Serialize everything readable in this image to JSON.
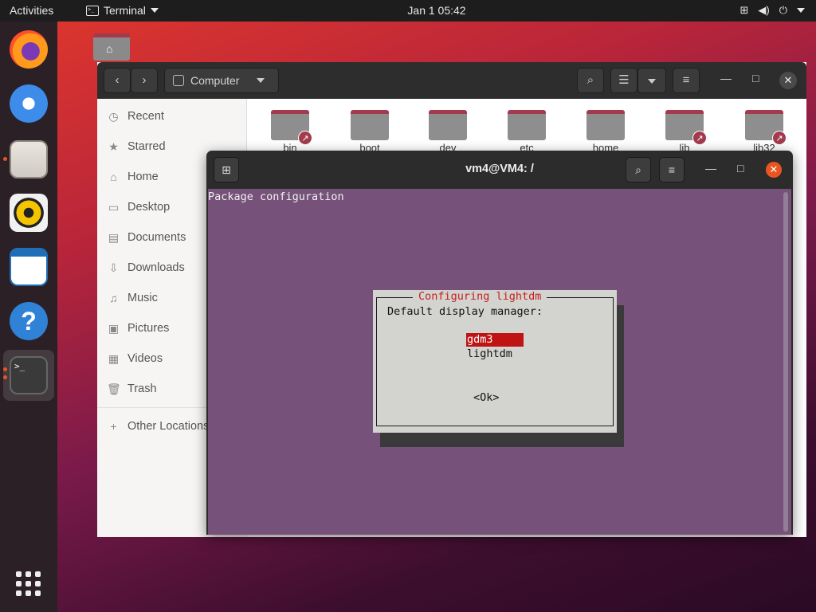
{
  "topbar": {
    "activities": "Activities",
    "app_name": "Terminal",
    "clock": "Jan 1  05:42"
  },
  "dock": {
    "items": [
      "firefox-icon",
      "thunderbird-icon",
      "files-icon",
      "rhythmbox-icon",
      "libreoffice-writer-icon",
      "help-icon",
      "terminal-icon"
    ],
    "help_glyph": "?",
    "terminal_glyph": ">_"
  },
  "desktop": {
    "home_icon": "home-folder-icon"
  },
  "files": {
    "path": "Computer",
    "sidebar": {
      "recent": "Recent",
      "starred": "Starred",
      "home": "Home",
      "desktop": "Desktop",
      "documents": "Documents",
      "downloads": "Downloads",
      "music": "Music",
      "pictures": "Pictures",
      "videos": "Videos",
      "trash": "Trash",
      "other": "Other Locations"
    },
    "folders": [
      "bin",
      "boot",
      "dev",
      "etc",
      "home",
      "lib",
      "lib32"
    ]
  },
  "terminal": {
    "title": "vm4@VM4: /",
    "header_text": "Package configuration",
    "dialog": {
      "title": "Configuring lightdm",
      "prompt": "Default display manager:",
      "options": [
        "gdm3",
        "lightdm"
      ],
      "selected": "gdm3",
      "ok": "<Ok>"
    }
  },
  "colors": {
    "accent": "#e95420",
    "terminal_bg": "#76527a",
    "dialog_bg": "#d3d3cf",
    "dialog_title": "#c61f1f",
    "selection": "#c01313"
  }
}
